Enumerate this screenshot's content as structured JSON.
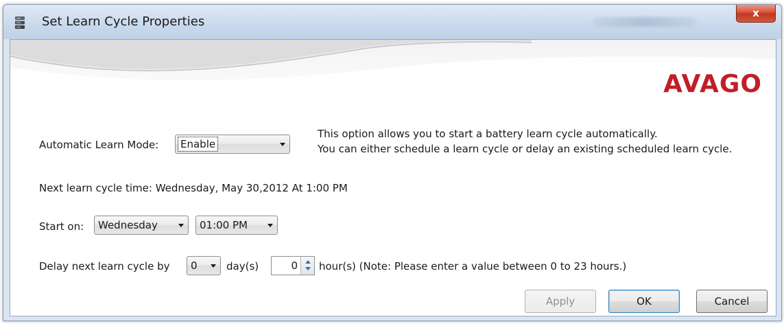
{
  "window": {
    "title": "Set Learn Cycle Properties",
    "close_label": "x"
  },
  "banner": {
    "logo_text": "AVAGO",
    "logo_color": "#c21e26"
  },
  "learn_mode": {
    "label": "Automatic Learn Mode:",
    "value": "Enable",
    "description_line1": "This option allows you to start a battery learn cycle automatically.",
    "description_line2": "You can either schedule a learn cycle or delay an existing scheduled learn cycle."
  },
  "next_cycle": {
    "text": "Next learn cycle time: Wednesday, May 30,2012 At 1:00 PM"
  },
  "start_on": {
    "label": "Start on:",
    "day_value": "Wednesday",
    "time_value": "01:00 PM"
  },
  "delay": {
    "label": "Delay next learn cycle by",
    "days_value": "0",
    "days_unit": "day(s)",
    "hours_value": "0",
    "hours_note": "hour(s) (Note: Please enter a value between 0 to 23 hours.)"
  },
  "buttons": {
    "apply": "Apply",
    "ok": "OK",
    "cancel": "Cancel"
  },
  "icons": {
    "app": "server-stack-icon",
    "close": "close-icon",
    "dropdown": "chevron-down-icon",
    "spinner": "spinner-arrows-icon"
  }
}
